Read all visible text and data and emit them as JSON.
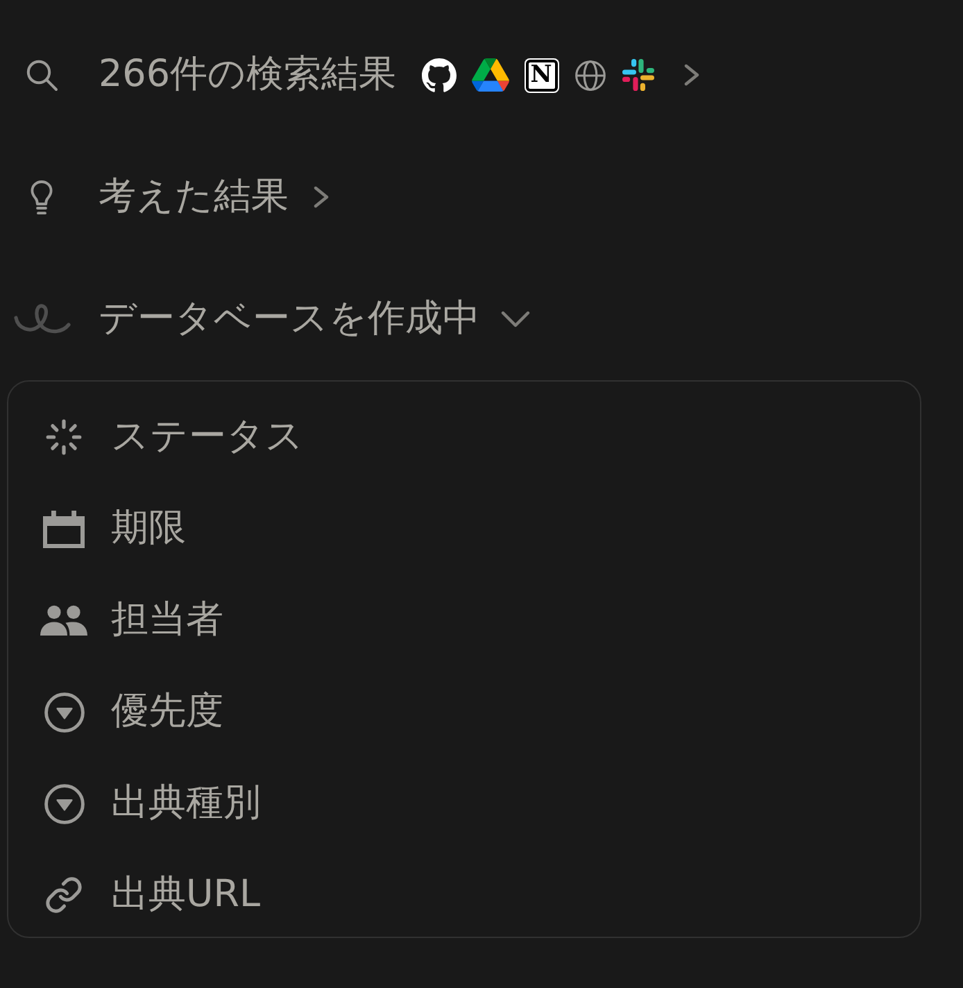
{
  "steps": [
    {
      "kind": "search",
      "label": "266件の検索結果",
      "expanded": false,
      "sources": [
        {
          "kind": "github"
        },
        {
          "kind": "drive"
        },
        {
          "kind": "notion",
          "mark": "N"
        },
        {
          "kind": "web"
        },
        {
          "kind": "slack"
        }
      ]
    },
    {
      "kind": "thinking",
      "label": "考えた結果",
      "expanded": false
    },
    {
      "kind": "building",
      "label": "データベースを作成中",
      "expanded": true,
      "properties": [
        {
          "kind": "status",
          "label": "ステータス"
        },
        {
          "kind": "date",
          "label": "期限"
        },
        {
          "kind": "person",
          "label": "担当者"
        },
        {
          "kind": "select",
          "label": "優先度"
        },
        {
          "kind": "select",
          "label": "出典種別"
        },
        {
          "kind": "url",
          "label": "出典URL"
        }
      ]
    }
  ]
}
